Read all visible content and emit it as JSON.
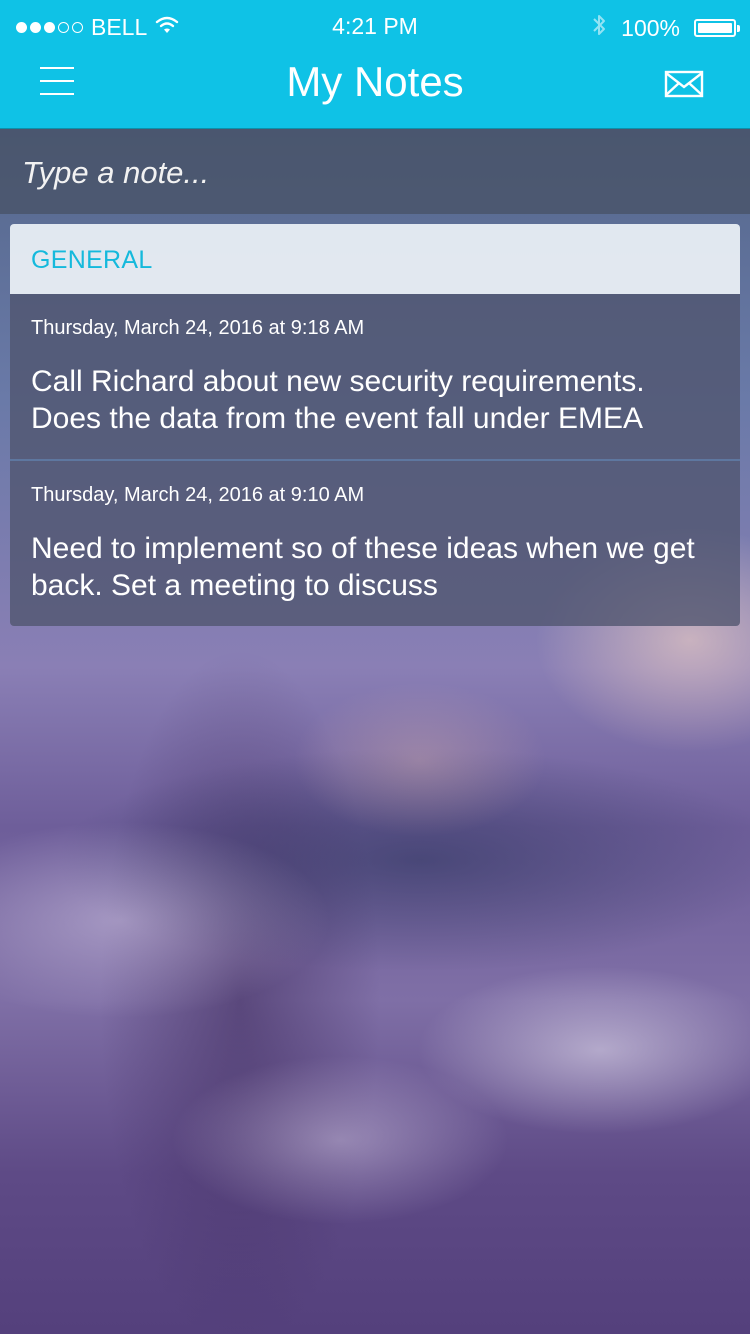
{
  "status_bar": {
    "carrier": "BELL",
    "signal_bars_filled": 3,
    "signal_bars_total": 5,
    "time": "4:21 PM",
    "battery": "100%",
    "icons": [
      "wifi-icon",
      "bluetooth-icon",
      "battery-icon"
    ]
  },
  "nav": {
    "title": "My Notes",
    "left_icon": "menu-icon",
    "right_icon": "mail-icon"
  },
  "input": {
    "placeholder": "Type a note...",
    "value": ""
  },
  "category": {
    "label": "GENERAL",
    "notes": [
      {
        "date": "Thursday, March 24, 2016 at 9:18 AM",
        "text": "Call Richard about new security requirements. Does the data from the event fall under EMEA"
      },
      {
        "date": "Thursday, March 24, 2016 at 9:10 AM",
        "text": "Need to implement so of these ideas when we get back. Set a meeting to discuss"
      }
    ]
  },
  "colors": {
    "accent": "#0fc2e6",
    "category_label": "#15b9dc",
    "header_bg": "#ecf1f6"
  }
}
